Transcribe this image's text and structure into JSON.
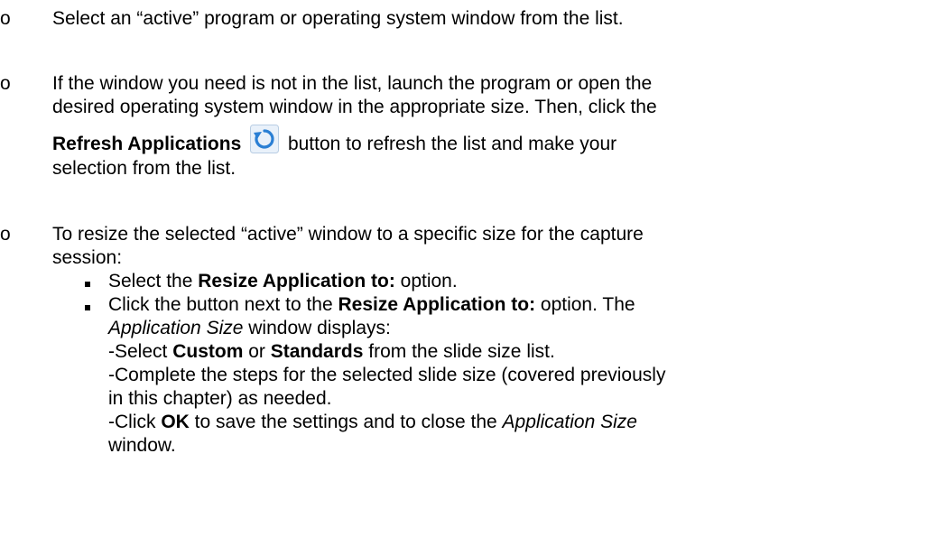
{
  "items": [
    {
      "marker": "o",
      "text": "Select an “active” program or operating system window from the list."
    },
    {
      "marker": "o",
      "line1": "If the window you need is not in the list, launch the program or open the",
      "line2": "desired operating system window in the appropriate size. Then, click the",
      "bold": "Refresh Applications",
      "icon": "refresh-icon",
      "line3_rest": " button to refresh the list and make your",
      "line4": "selection from the list."
    },
    {
      "marker": "o",
      "line1": "To resize the selected “active” window to a specific size for the capture",
      "line2": "session:",
      "sub_items": [
        {
          "pre": "Select the ",
          "bold": "Resize Application to:",
          "post": " option."
        },
        {
          "pre": "Click the button next to the ",
          "bold": "Resize Application to:",
          "post": " option. The",
          "line2_italic": "Application Size",
          "line2_post": " window displays:",
          "line3_pre": "-Select ",
          "line3_bold1": "Custom",
          "line3_mid": " or ",
          "line3_bold2": "Standards",
          "line3_post": " from the slide size list.",
          "line4": "-Complete the steps for the selected slide size (covered previously",
          "line5": "in this chapter) as needed.",
          "line6_pre": "-Click ",
          "line6_bold": "OK",
          "line6_mid": " to save the settings and to close the ",
          "line6_italic": "Application Size",
          "line7": "window."
        }
      ]
    }
  ],
  "colors": {
    "text": "#000000",
    "icon_blue": "#2a7fd4",
    "icon_bg": "#dbe9f7"
  }
}
